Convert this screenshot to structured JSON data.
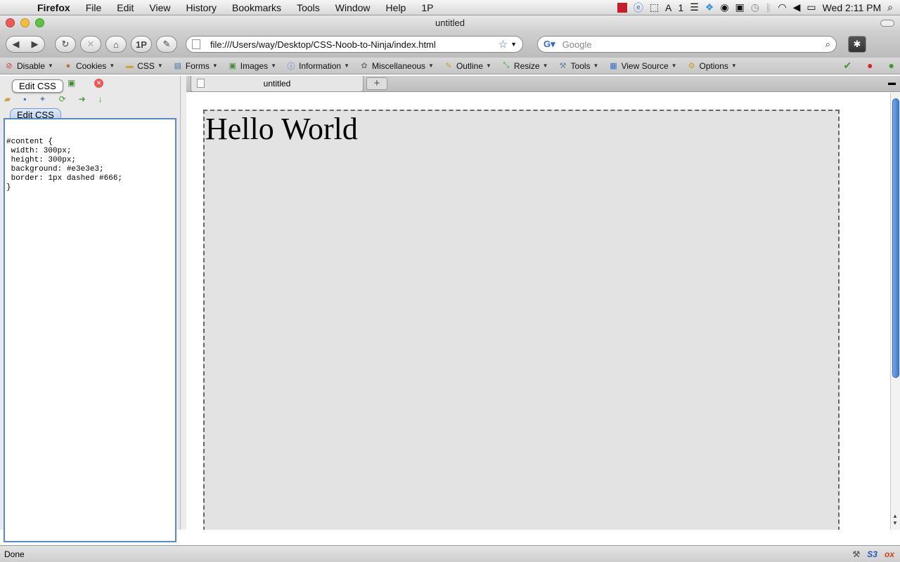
{
  "menubar": {
    "app": "Firefox",
    "items": [
      "File",
      "Edit",
      "View",
      "History",
      "Bookmarks",
      "Tools",
      "Window",
      "Help",
      "1P"
    ],
    "clock": "Wed 2:11 PM",
    "badge_count": "1"
  },
  "window": {
    "title": "untitled"
  },
  "nav": {
    "url": "file:///Users/way/Desktop/CSS-Noob-to-Ninja/index.html",
    "search_placeholder": "Google",
    "onepassword": "1P"
  },
  "devbar": {
    "items": [
      "Disable",
      "Cookies",
      "CSS",
      "Forms",
      "Images",
      "Information",
      "Miscellaneous",
      "Outline",
      "Resize",
      "Tools",
      "View Source",
      "Options"
    ]
  },
  "sidebar": {
    "tooltip": "Edit CSS",
    "tab": "Edit CSS",
    "code": "#content {\n width: 300px;\n height: 300px;\n background: #e3e3e3;\n border: 1px dashed #666;\n}"
  },
  "tab": {
    "label": "untitled",
    "new": "+"
  },
  "page": {
    "heading": "Hello World"
  },
  "status": {
    "text": "Done",
    "right1": "S3",
    "right2": "ox"
  },
  "colors": {
    "content_bg": "#e3e3e3",
    "border": "#666666",
    "accent": "#3b78d6"
  }
}
